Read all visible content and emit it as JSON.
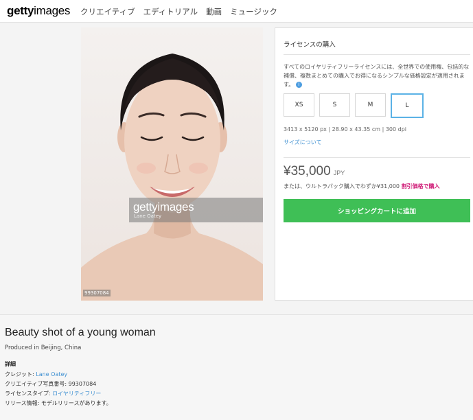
{
  "header": {
    "logo_bold": "getty",
    "logo_light": "images",
    "nav": [
      "クリエイティブ",
      "エディトリアル",
      "動画",
      "ミュージック"
    ]
  },
  "image": {
    "watermark_logo": "gettyimages",
    "watermark_credit": "Lane Oatey",
    "id_label": "99307084"
  },
  "license": {
    "title": "ライセンスの購入",
    "description": "すべてのロイヤリティフリーライセンスには、全世界での使用権、包括的な補償、複数まとめての購入でお得になるシンプルな価格設定が適用されます。",
    "info_icon": "i",
    "sizes": [
      "XS",
      "S",
      "M",
      "L"
    ],
    "selected_size": "L",
    "dimensions": "3413 x 5120 px | 28.90 x 43.35 cm | 300 dpi",
    "size_link": "サイズについて",
    "price": "¥35,000",
    "currency": "JPY",
    "ultra_text": "または、ウルトラパック購入でわずか¥31,000",
    "ultra_link": "割引価格で購入",
    "cart_button": "ショッピングカートに追加"
  },
  "details": {
    "title": "Beauty shot of a young woman",
    "produced": "Produced in Beijing, China",
    "heading": "詳細",
    "credit_label": "クレジット: ",
    "credit_value": "Lane Oatey",
    "number_label": "クリエイティブ写真番号: ",
    "number_value": "99307084",
    "license_label": "ライセンスタイプ: ",
    "license_value": "ロイヤリティフリー",
    "release_label": "リリース情報: ",
    "release_value": "モデルリリースがあります。"
  },
  "colors": {
    "accent_green": "#3fbf56",
    "link_blue": "#3d8fd1",
    "discount_pink": "#d0207a",
    "selected_border": "#5bb2e6"
  }
}
